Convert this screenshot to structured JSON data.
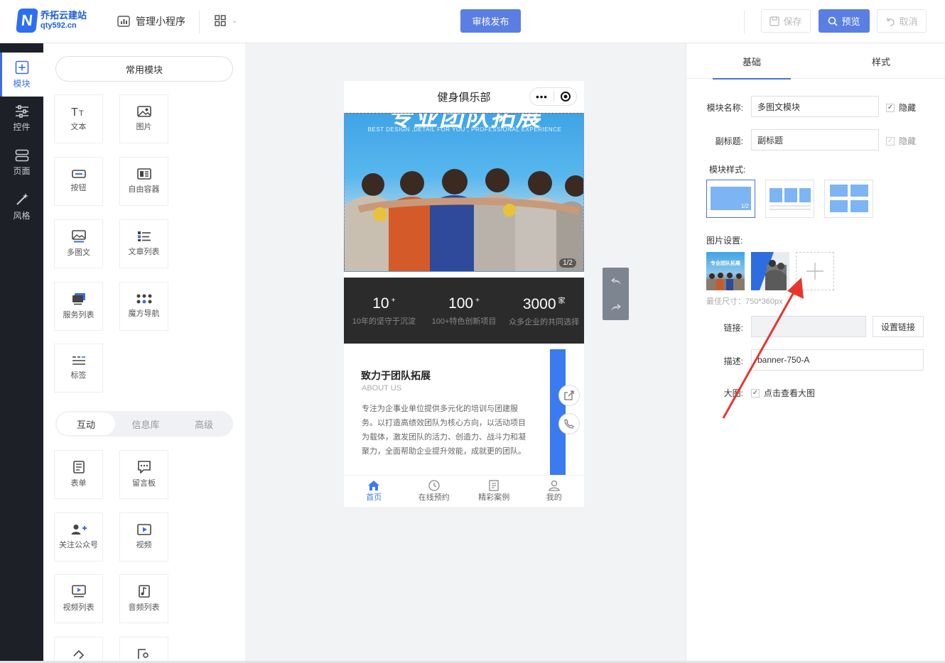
{
  "brand": {
    "name": "乔拓云建站",
    "domain": "qty592.cn",
    "mark": "N"
  },
  "topbar": {
    "manage_label": "管理小程序",
    "publish_label": "审核发布",
    "save_label": "保存",
    "preview_label": "预览",
    "cancel_label": "取消"
  },
  "leftnav": {
    "items": [
      {
        "label": "模块"
      },
      {
        "label": "控件"
      },
      {
        "label": "页面"
      },
      {
        "label": "风格"
      }
    ]
  },
  "modules": {
    "common_label": "常用模块",
    "common": [
      {
        "label": "文本",
        "icon": "text-icon"
      },
      {
        "label": "图片",
        "icon": "image-icon"
      },
      {
        "label": "按钮",
        "icon": "button-icon"
      },
      {
        "label": "自由容器",
        "icon": "container-icon"
      },
      {
        "label": "多图文",
        "icon": "multi-image-text-icon"
      },
      {
        "label": "文章列表",
        "icon": "article-list-icon"
      },
      {
        "label": "服务列表",
        "icon": "service-list-icon"
      },
      {
        "label": "魔方导航",
        "icon": "cube-nav-icon"
      },
      {
        "label": "标签",
        "icon": "tag-icon"
      }
    ],
    "tabs": [
      "互动",
      "信息库",
      "高级"
    ],
    "interactive": [
      {
        "label": "表单",
        "icon": "form-icon"
      },
      {
        "label": "留言板",
        "icon": "message-board-icon"
      },
      {
        "label": "关注公众号",
        "icon": "follow-account-icon"
      },
      {
        "label": "视频",
        "icon": "video-icon"
      },
      {
        "label": "视频列表",
        "icon": "video-list-icon"
      },
      {
        "label": "音频列表",
        "icon": "audio-list-icon"
      }
    ]
  },
  "phone": {
    "title": "健身俱乐部",
    "banner": {
      "headline": "专业团队拓展",
      "subline": "BEST DESIGN ,DETAIL FOR YOU , PROFESSIONAL EXPERIENCE",
      "counter": "1/2"
    },
    "stats": [
      {
        "num": "10",
        "unit": "+",
        "label": "10年的坚守于沉淀"
      },
      {
        "num": "100",
        "unit": "+",
        "label": "100+特色创新项目"
      },
      {
        "num": "3000",
        "unit": "家",
        "label": "众多企业的共同选择"
      }
    ],
    "about": {
      "title": "致力于团队拓展",
      "en": "ABOUT US",
      "body": "专注为企事业单位提供多元化的培训与团建服务。以打造高绩效团队为核心方向，以活动项目为载体，激发团队的活力、创造力、战斗力和凝聚力，全面帮助企业提升效能，成就更的团队。"
    },
    "tabbar": [
      {
        "label": "首页"
      },
      {
        "label": "在线预约"
      },
      {
        "label": "精彩案例"
      },
      {
        "label": "我的"
      }
    ]
  },
  "props": {
    "tabs": [
      "基础",
      "样式"
    ],
    "name_label": "模块名称:",
    "name_value": "多图文模块",
    "hide_label": "隐藏",
    "subtitle_label": "副标题:",
    "subtitle_value": "副标题",
    "hide2_label": "隐藏",
    "style_label": "模块样式:",
    "style_badge": "1/2",
    "image_label": "图片设置:",
    "image1_text": "专业团队拓展",
    "size_hint": "最佳尺寸：750*360px",
    "link_label": "链接:",
    "link_value": "",
    "setlink_label": "设置链接",
    "desc_label": "描述:",
    "desc_value": "banner-750-A",
    "bigimg_label": "大图:",
    "bigimg_check_label": "点击查看大图"
  },
  "colors": {
    "accent": "#5b7ee3",
    "nav_bg": "#1d2027",
    "tab_blue": "#3b7bf0",
    "arrow": "#e8362d"
  }
}
